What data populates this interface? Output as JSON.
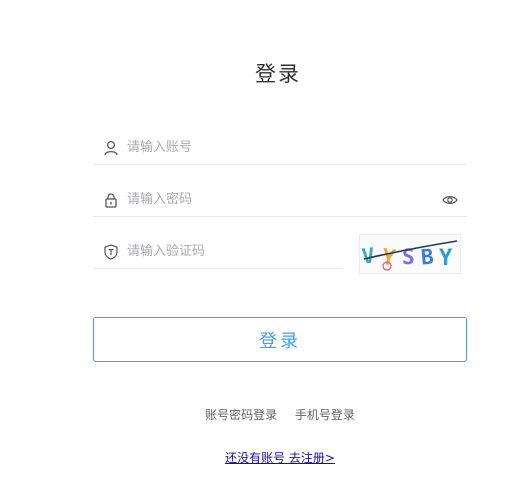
{
  "title": "登录",
  "username": {
    "placeholder": "请输入账号",
    "value": ""
  },
  "password": {
    "placeholder": "请输入密码",
    "value": ""
  },
  "captcha": {
    "placeholder": "请输入验证码",
    "value": "",
    "image_text": "VYSBY"
  },
  "login_button": "登录",
  "login_modes": [
    "账号密码登录",
    "手机号登录"
  ],
  "register_link": "还没有账号 去注册>",
  "colors": {
    "accent": "#409eff",
    "text": "#333333",
    "placeholder": "#a8abb2",
    "link": "#1a0dab"
  }
}
